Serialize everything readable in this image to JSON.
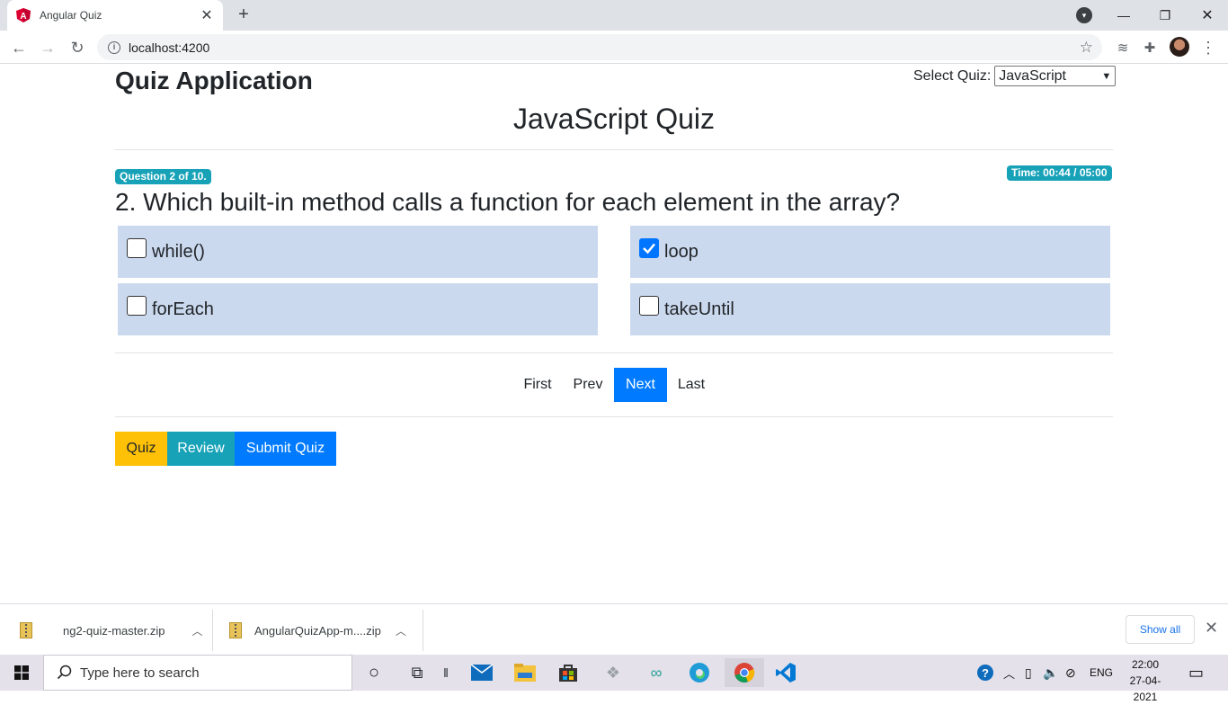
{
  "browser": {
    "tab_title": "Angular Quiz",
    "url": "localhost:4200"
  },
  "app": {
    "title": "Quiz Application",
    "select_label": "Select Quiz:",
    "selected_quiz": "JavaScript",
    "quiz_name": "JavaScript Quiz"
  },
  "question": {
    "counter": "Question 2 of 10.",
    "timer": "Time: 00:44 / 05:00",
    "text": "2. Which built-in method calls a function for each element in the array?",
    "options": [
      {
        "label": "while()",
        "checked": false
      },
      {
        "label": "loop",
        "checked": true
      },
      {
        "label": "forEach",
        "checked": false
      },
      {
        "label": "takeUntil",
        "checked": false
      }
    ]
  },
  "pagination": {
    "first": "First",
    "prev": "Prev",
    "next": "Next",
    "last": "Last",
    "active": "Next"
  },
  "mode_buttons": {
    "quiz": "Quiz",
    "review": "Review",
    "submit": "Submit Quiz",
    "colors": {
      "quiz": "#ffc107",
      "review": "#17a2b8",
      "submit": "#007bff"
    }
  },
  "downloads": {
    "items": [
      "ng2-quiz-master.zip",
      "AngularQuizApp-m....zip"
    ],
    "show_all": "Show all"
  },
  "taskbar": {
    "search_placeholder": "Type here to search",
    "language": "ENG",
    "time": "22:00",
    "date": "27-04-2021"
  }
}
